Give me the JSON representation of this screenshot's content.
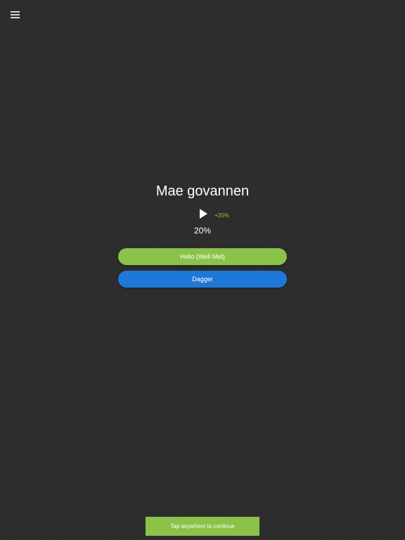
{
  "header": {
    "menu_icon": "hamburger-menu-icon"
  },
  "card": {
    "word": "Mae govannen",
    "play_icon": "play-icon",
    "gain": "+20%",
    "progress_text": "20%",
    "progress_value": 20
  },
  "answers": [
    {
      "label": "Hello (Well Met)",
      "color": "#8bc34a"
    },
    {
      "label": "Dagger",
      "color": "#1e78d8"
    }
  ],
  "footer": {
    "continue_label": "Tap anywhere to continue",
    "color": "#8bc34a"
  }
}
